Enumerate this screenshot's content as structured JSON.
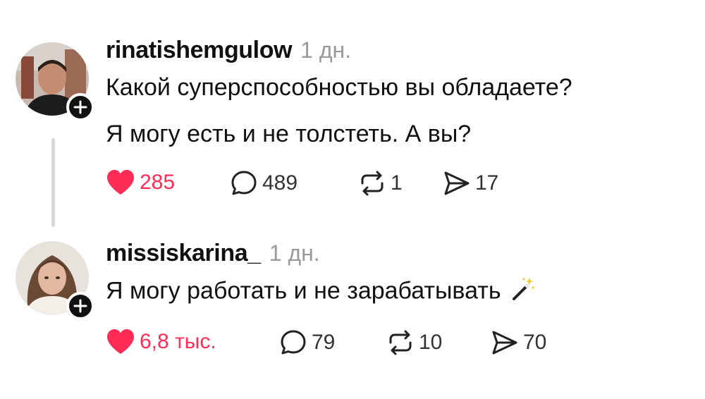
{
  "posts": [
    {
      "username": "rinatishemgulow",
      "time": "1 дн.",
      "lines": [
        "Какой суперспособностью вы обладаете?",
        "Я могу есть и не толстеть. А вы?"
      ],
      "stats": {
        "likes": "285",
        "comments": "489",
        "reposts": "1",
        "shares": "17"
      },
      "avatar_icon": "man-portrait-icon"
    },
    {
      "username": "missiskarina_",
      "time": "1 дн.",
      "lines": [
        "Я могу работать и не зарабатывать"
      ],
      "emoji_icon": "magic-wand-icon",
      "stats": {
        "likes": "6,8 тыс.",
        "comments": "79",
        "reposts": "10",
        "shares": "70"
      },
      "avatar_icon": "woman-portrait-icon"
    }
  ],
  "colors": {
    "like": "#ff2d55",
    "text": "#111111",
    "muted": "#999999",
    "thread_line": "#d9d9d9"
  }
}
